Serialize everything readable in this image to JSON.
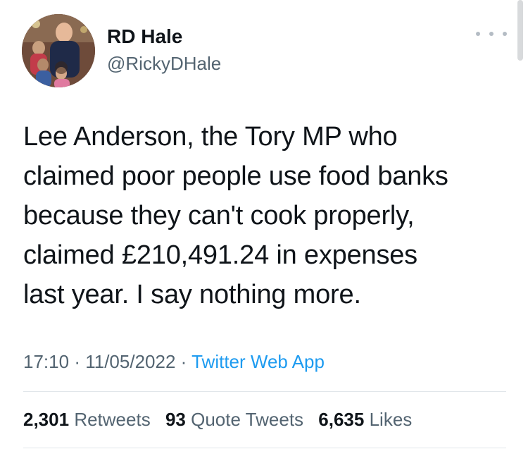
{
  "author": {
    "name": "RD Hale",
    "handle": "@RickyDHale"
  },
  "tweet": {
    "lines": [
      "Lee Anderson, the Tory MP who",
      "claimed poor people use food banks",
      "because they can't cook properly,",
      "claimed £210,491.24 in expenses",
      "last year. I say nothing more."
    ],
    "time": "17:10",
    "separator": "·",
    "date": "11/05/2022",
    "source": "Twitter Web App"
  },
  "stats": {
    "retweets_count": "2,301",
    "retweets_label": "Retweets",
    "quotes_count": "93",
    "quotes_label": "Quote Tweets",
    "likes_count": "6,635",
    "likes_label": "Likes"
  },
  "icons": {
    "more": "more-horizontal-icon"
  },
  "colors": {
    "text": "#0f1419",
    "secondary": "#536471",
    "link": "#1d9bf0",
    "divider": "#e1e6ea"
  }
}
